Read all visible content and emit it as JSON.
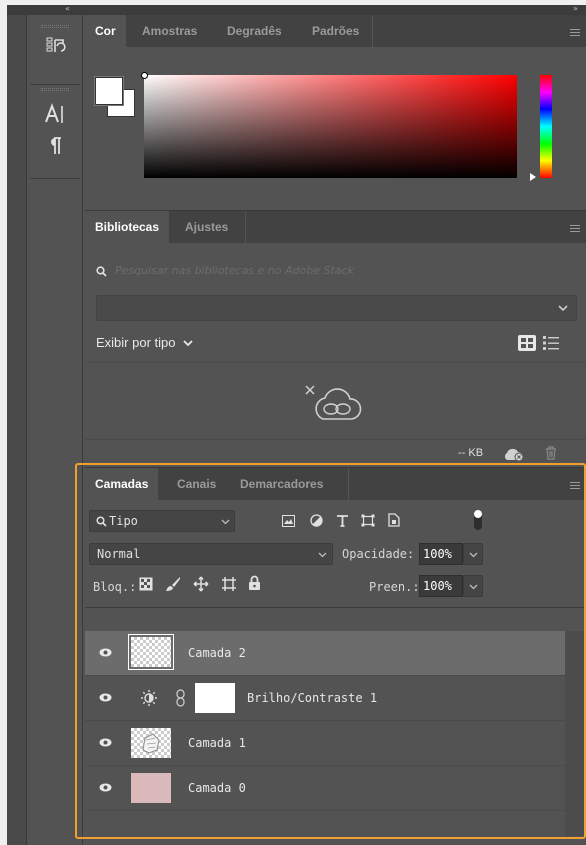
{
  "topbar": {
    "collapse_left": "«",
    "collapse_right": "»"
  },
  "color_panel": {
    "tabs": [
      "Cor",
      "Amostras",
      "Degradês",
      "Padrões"
    ],
    "active_tab": "Cor",
    "picker_hue": "#ff0000"
  },
  "libraries_panel": {
    "tabs": [
      "Bibliotecas",
      "Ajustes"
    ],
    "search_placeholder": "Pesquisar nas bibliotecas e no Adobe Stack",
    "dropdown_value": "",
    "view_by": "Exibir por tipo",
    "storage": "-- KB"
  },
  "layers_panel": {
    "tabs": [
      "Camadas",
      "Canais",
      "Demarcadores"
    ],
    "filter_label": "Tipo",
    "blend_mode": "Normal",
    "opacity_label": "Opacidade:",
    "opacity_value": "100%",
    "lock_label": "Bloq.:",
    "fill_label": "Preen.:",
    "fill_value": "100%",
    "highlight_color": "#f0a030",
    "layers": [
      {
        "name": "Camada 2",
        "selected": true,
        "thumb": "checker"
      },
      {
        "name": "Brilho/Contraste 1",
        "selected": false,
        "thumb": "adjustment"
      },
      {
        "name": "Camada 1",
        "selected": false,
        "thumb": "sketch"
      },
      {
        "name": "Camada 0",
        "selected": false,
        "thumb": "#d9b9b9"
      }
    ]
  }
}
